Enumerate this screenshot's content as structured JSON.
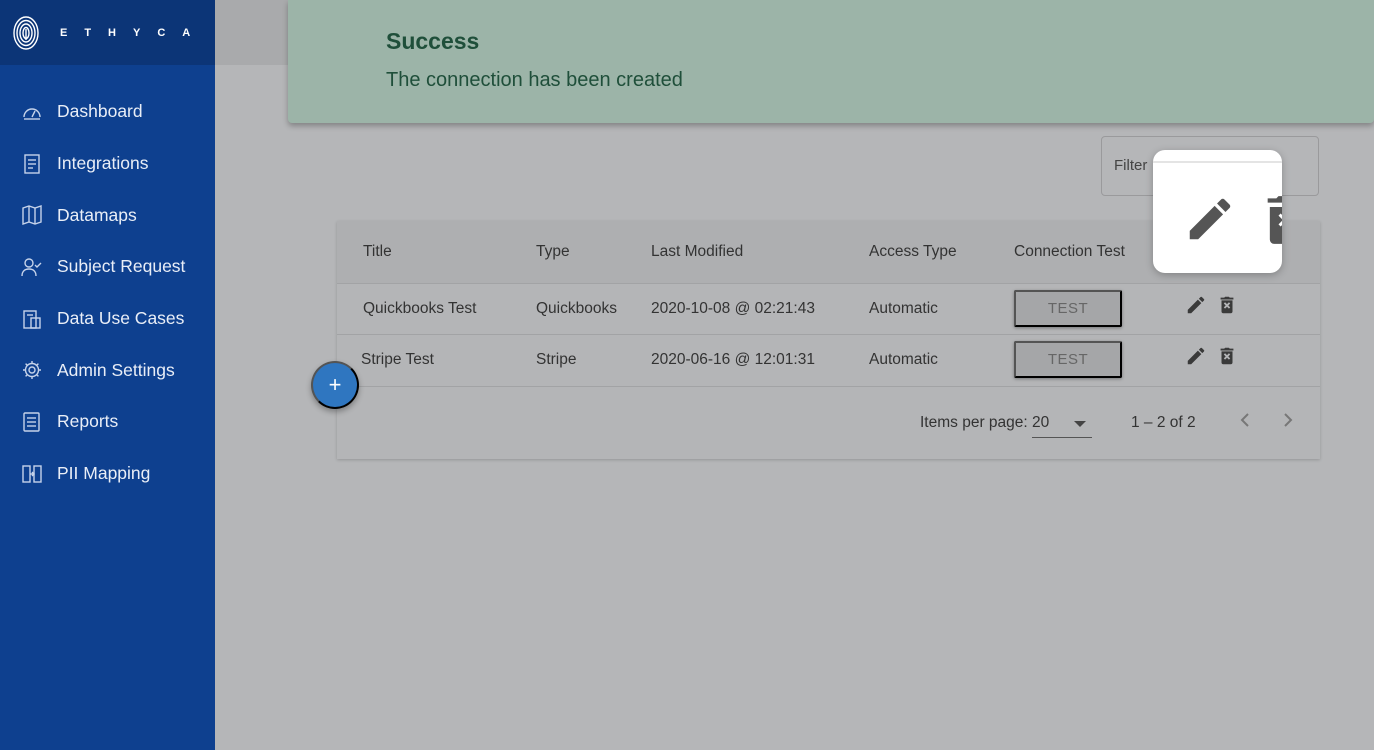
{
  "brand": {
    "name": "ETHYCA"
  },
  "sidebar": {
    "items": [
      {
        "label": "Dashboard",
        "icon": "gauge-icon"
      },
      {
        "label": "Integrations",
        "icon": "document-icon"
      },
      {
        "label": "Datamaps",
        "icon": "map-icon"
      },
      {
        "label": "Subject Request",
        "icon": "user-check-icon"
      },
      {
        "label": "Data Use Cases",
        "icon": "clipboard-icon"
      },
      {
        "label": "Admin Settings",
        "icon": "gear-icon"
      },
      {
        "label": "Reports",
        "icon": "report-icon"
      },
      {
        "label": "PII Mapping",
        "icon": "mapping-icon"
      }
    ]
  },
  "toast": {
    "title": "Success",
    "message": "The connection has been created"
  },
  "filter": {
    "label": "Filter"
  },
  "table": {
    "columns": [
      "Title",
      "Type",
      "Last Modified",
      "Access Type",
      "Connection Test"
    ],
    "rows": [
      {
        "title": "Quickbooks Test",
        "type": "Quickbooks",
        "last_modified": "2020-10-08 @ 02:21:43",
        "access_type": "Automatic",
        "test_label": "TEST"
      },
      {
        "title": "Stripe Test",
        "type": "Stripe",
        "last_modified": "2020-06-16 @ 12:01:31",
        "access_type": "Automatic",
        "test_label": "TEST"
      }
    ]
  },
  "pagination": {
    "items_per_page_label": "Items per page:",
    "items_per_page": "20",
    "range": "1 – 2 of 2"
  },
  "fab": {
    "label": "+"
  },
  "colors": {
    "sidebar": "#0e408f",
    "toast_bg": "#9cb4a8",
    "toast_text": "#1f4f3a",
    "fab": "#2f76c0"
  }
}
